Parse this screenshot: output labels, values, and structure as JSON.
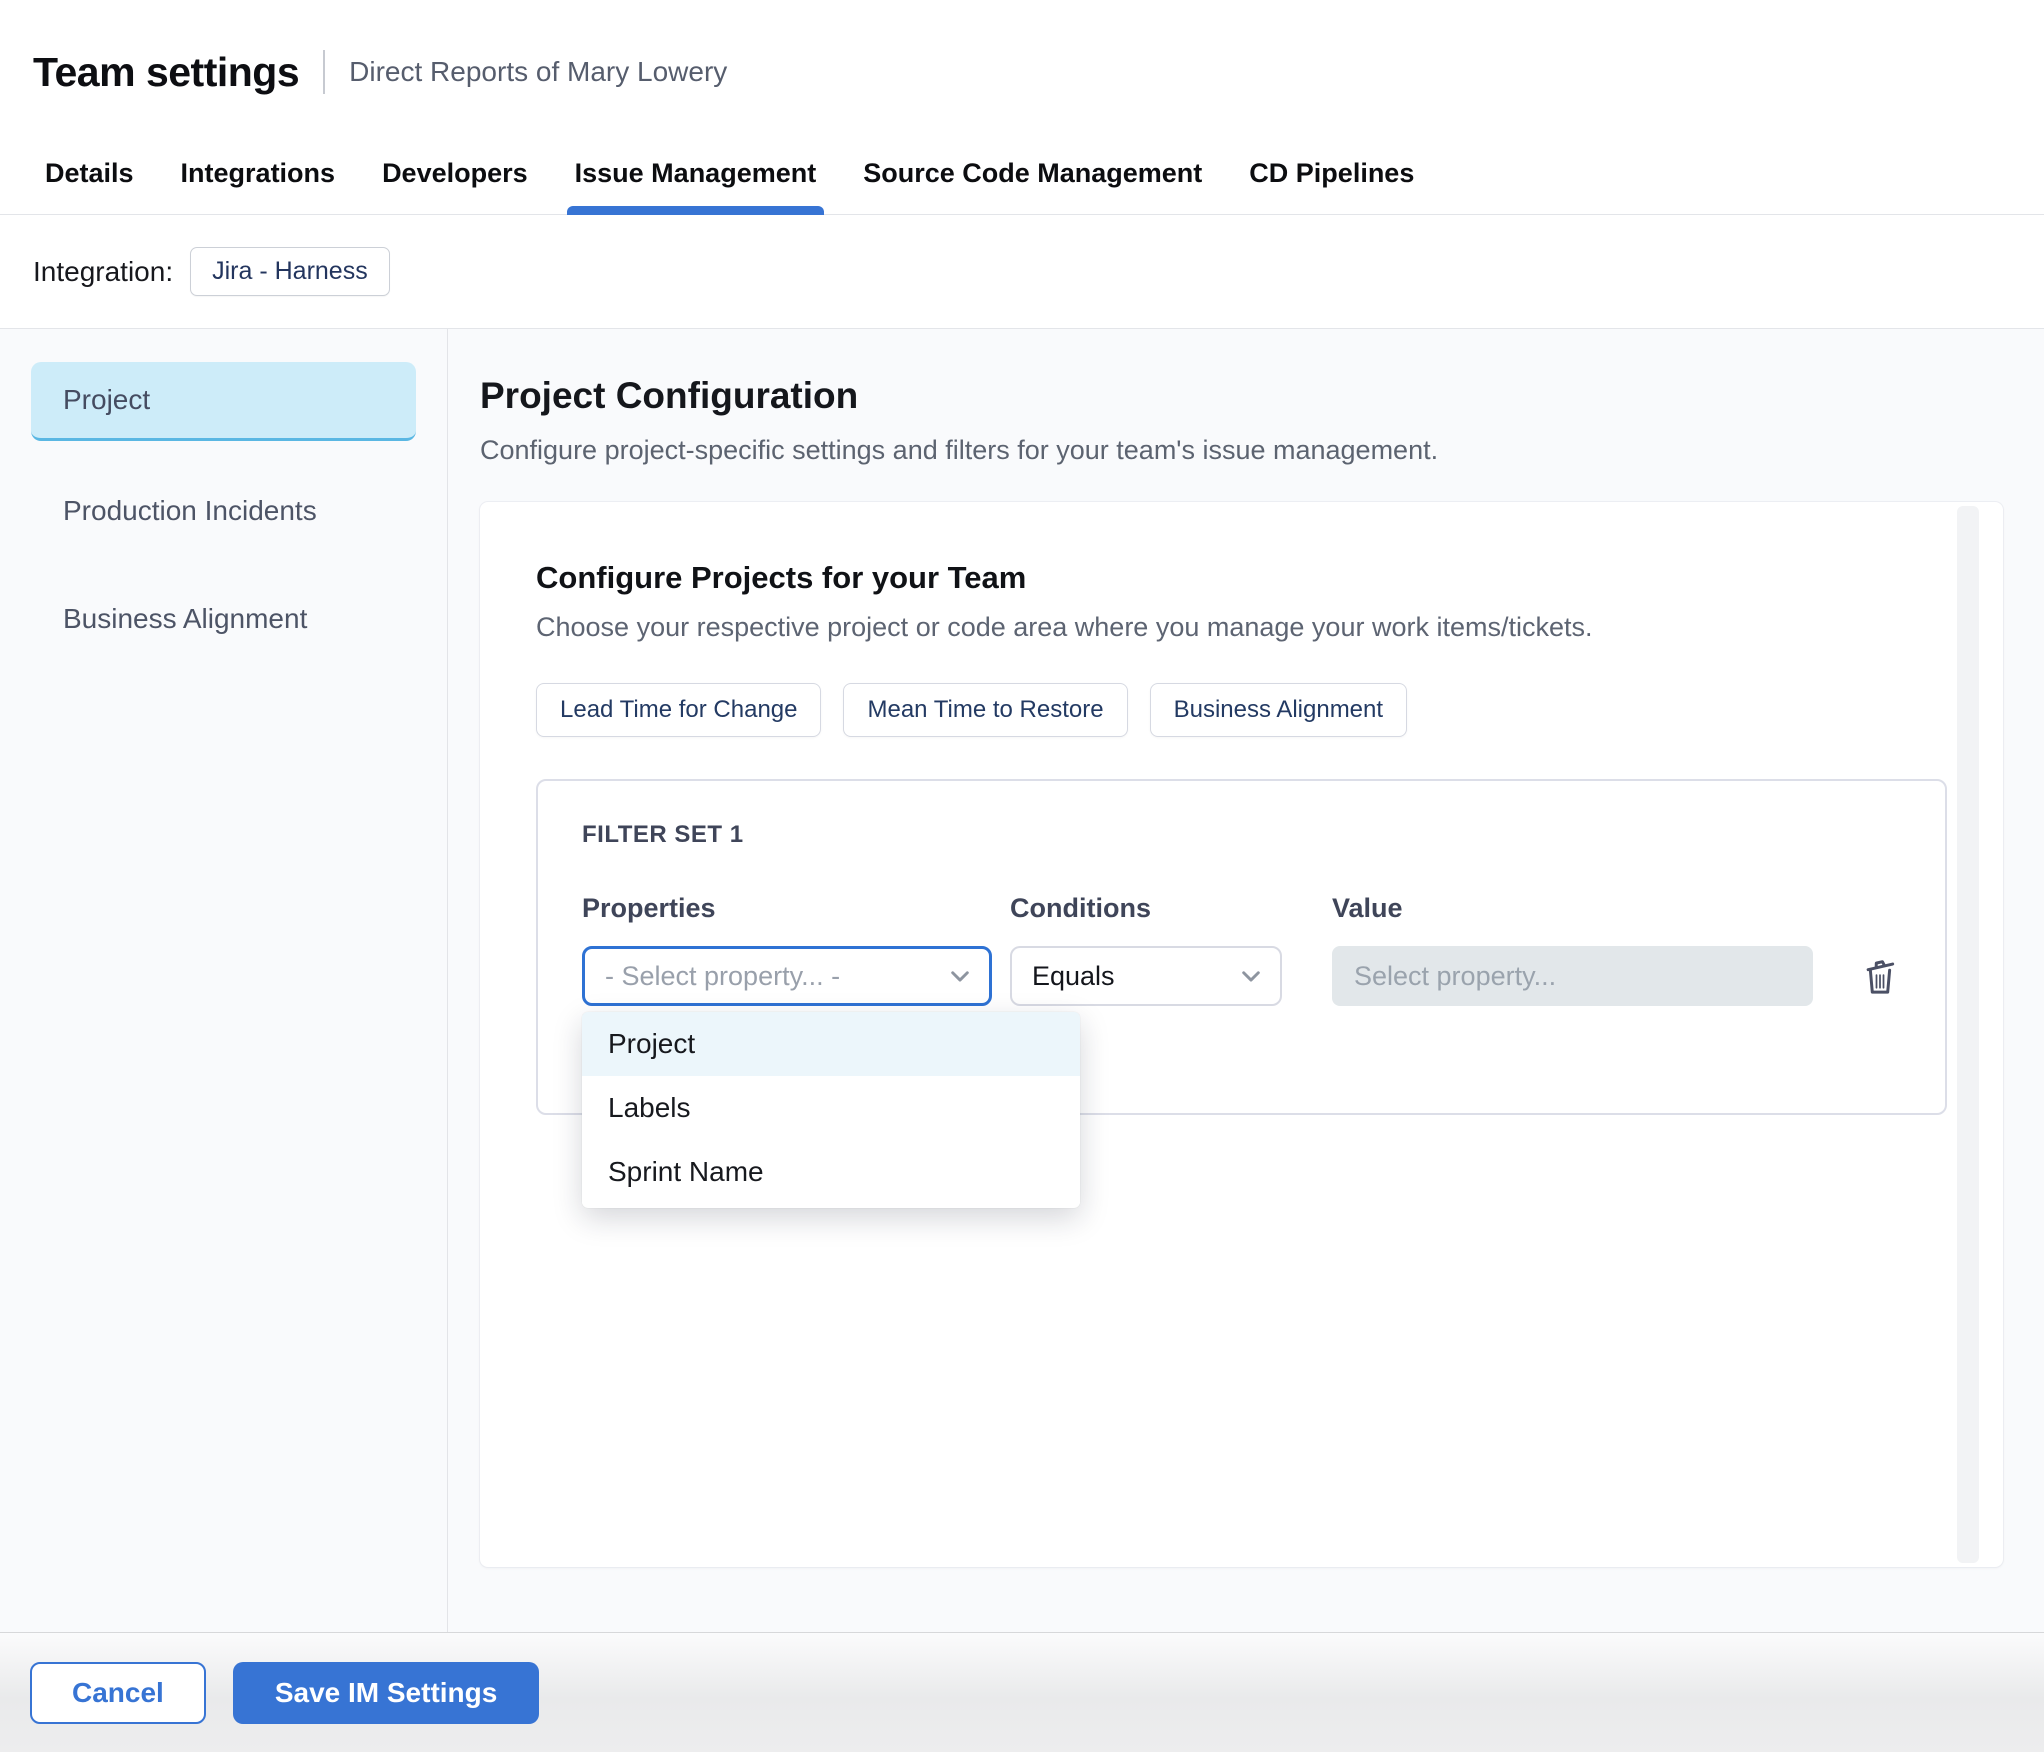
{
  "header": {
    "title": "Team settings",
    "subtitle": "Direct Reports of Mary Lowery"
  },
  "tabs": {
    "items": [
      "Details",
      "Integrations",
      "Developers",
      "Issue Management",
      "Source Code Management",
      "CD Pipelines"
    ],
    "active": "Issue Management"
  },
  "integration": {
    "label": "Integration:",
    "value": "Jira - Harness"
  },
  "sidebar": {
    "items": [
      {
        "label": "Project",
        "selected": true
      },
      {
        "label": "Production Incidents",
        "selected": false
      },
      {
        "label": "Business Alignment",
        "selected": false
      }
    ]
  },
  "main": {
    "title": "Project Configuration",
    "subtitle": "Configure project-specific settings and filters for your team's issue management.",
    "card": {
      "title": "Configure Projects for your Team",
      "subtitle": "Choose your respective project or code area where you manage your work items/tickets.",
      "metric_chips": [
        "Lead Time for Change",
        "Mean Time to Restore",
        "Business Alignment"
      ]
    }
  },
  "filter_set": {
    "title": "FILTER SET 1",
    "columns": {
      "properties": "Properties",
      "conditions": "Conditions",
      "value": "Value"
    },
    "property_select": {
      "placeholder": "- Select property... -"
    },
    "condition_select": {
      "value": "Equals"
    },
    "value_input": {
      "placeholder": "Select property..."
    },
    "dropdown": {
      "options": [
        "Project",
        "Labels",
        "Sprint Name"
      ],
      "highlighted": "Project"
    },
    "icons": [
      "chevron-down-icon",
      "trash-icon"
    ]
  },
  "footer": {
    "cancel_label": "Cancel",
    "save_label": "Save IM Settings"
  },
  "colors": {
    "primary_blue": "#3774d4",
    "active_tab_underline": "#3774d4",
    "sidebar_selected_bg": "#cdecf9",
    "sidebar_selected_border": "#5ab7e3",
    "dropdown_highlight": "#ecf6fb",
    "value_input_bg": "#e2e7ea",
    "chip_text": "#23355e",
    "page_bg": "#f9fafc"
  }
}
